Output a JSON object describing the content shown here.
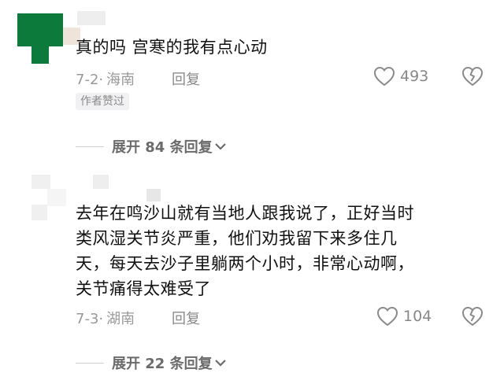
{
  "comments": [
    {
      "text_lines": [
        "真的吗 宫寒的我有点心动"
      ],
      "date": "7-2",
      "location": "海南",
      "reply_label": "回复",
      "likes": "493",
      "badge": "作者赞过",
      "expand_label": "展开 84 条回复"
    },
    {
      "text_lines": [
        "去年在鸣沙山就有当地人跟我说了，正好当时",
        "类风湿关节炎严重，他们劝我留下来多住几",
        "天，每天去沙子里躺两个小时，非常心动啊，",
        "关节痛得太难受了"
      ],
      "date": "7-3",
      "location": "湖南",
      "reply_label": "回复",
      "likes": "104",
      "expand_label": "展开 22 条回复"
    }
  ],
  "colors": {
    "avatar_green": "#0b7a3a",
    "text": "#111111",
    "meta": "#999999"
  },
  "icons": [
    "heart-outline-icon",
    "broken-heart-icon",
    "chevron-down-icon"
  ]
}
